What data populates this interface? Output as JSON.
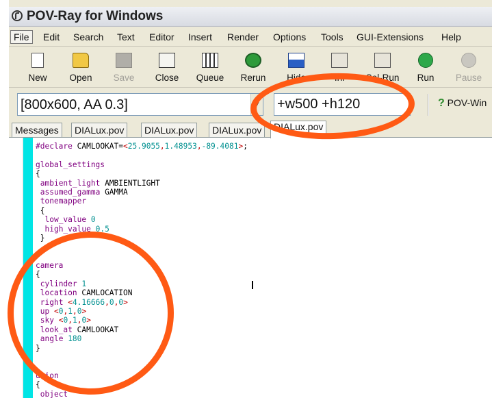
{
  "window": {
    "title": "POV-Ray for Windows"
  },
  "menubar": {
    "items": [
      "File",
      "Edit",
      "Search",
      "Text",
      "Editor",
      "Insert",
      "Render",
      "Options",
      "Tools",
      "GUI-Extensions",
      "Help"
    ]
  },
  "toolbar": {
    "buttons": [
      {
        "label": "New",
        "icon": "new-file-icon",
        "enabled": true
      },
      {
        "label": "Open",
        "icon": "open-folder-icon",
        "enabled": true
      },
      {
        "label": "Save",
        "icon": "save-disk-icon",
        "enabled": false
      },
      {
        "label": "Close",
        "icon": "close-file-icon",
        "enabled": true
      },
      {
        "label": "Queue",
        "icon": "queue-icon",
        "enabled": true
      },
      {
        "label": "Rerun",
        "icon": "rerun-icon",
        "enabled": true
      },
      {
        "label": "Hide",
        "icon": "hide-window-icon",
        "enabled": true
      },
      {
        "label": "Ini",
        "icon": "ini-icon",
        "enabled": true
      },
      {
        "label": "Sel-Run",
        "icon": "sel-run-icon",
        "enabled": true
      },
      {
        "label": "Run",
        "icon": "run-icon",
        "enabled": true
      },
      {
        "label": "Pause",
        "icon": "pause-icon",
        "enabled": false
      }
    ]
  },
  "options": {
    "resolution_selected": "[800x600, AA 0.3]",
    "command_line": "+w500 +h120",
    "help_label": "POV-Win"
  },
  "tabs": [
    {
      "label": "Messages",
      "active": false
    },
    {
      "label": "DIALux.pov",
      "active": false
    },
    {
      "label": "DIALux.pov",
      "active": false
    },
    {
      "label": "DIALux.pov",
      "active": false
    },
    {
      "label": "DIALux.pov",
      "active": true
    }
  ],
  "editor": {
    "lines": [
      "#declare CAMLOOKAT=<25.9055,1.48953,-89.4081>;",
      "",
      "global_settings",
      "{",
      " ambient_light AMBIENTLIGHT",
      " assumed_gamma GAMMA",
      " tonemapper",
      " {",
      "  low_value 0",
      "  high_value 0.5",
      " }",
      "",
      "",
      "camera",
      "{",
      " cylinder 1",
      " location CAMLOCATION",
      " right <4.16666,0,0>",
      " up <0,1,0>",
      " sky <0,1,0>",
      " look_at CAMLOOKAT",
      " angle 180",
      "}",
      "",
      "",
      "union",
      "{",
      " object"
    ]
  },
  "colors": {
    "annotation": "#ff5a14",
    "editor_margin": "#00e5e5",
    "keyword": "#800080",
    "number": "#009090",
    "vector": "#c00000"
  }
}
